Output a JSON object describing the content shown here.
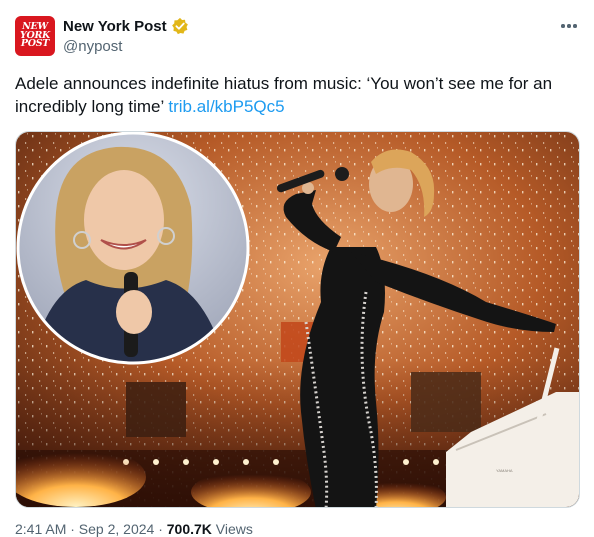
{
  "account": {
    "display_name": "New York Post",
    "handle": "@nypost",
    "logo_lines": [
      "NEW",
      "YORK",
      "POST"
    ],
    "verified": "gold-check",
    "brand_color": "#d9171f"
  },
  "tweet": {
    "text": "Adele announces indefinite hiatus from music: ‘You won’t see me for an incredibly long time’ ",
    "link_text": "trib.al/kbP5Qc5",
    "link_color": "#1d9bf0"
  },
  "media": {
    "piano_brand": "YAMAHA"
  },
  "footer": {
    "time_date": "2:41 AM · Sep 2, 2024 · ",
    "views_count": "700.7K",
    "views_label": " Views"
  }
}
